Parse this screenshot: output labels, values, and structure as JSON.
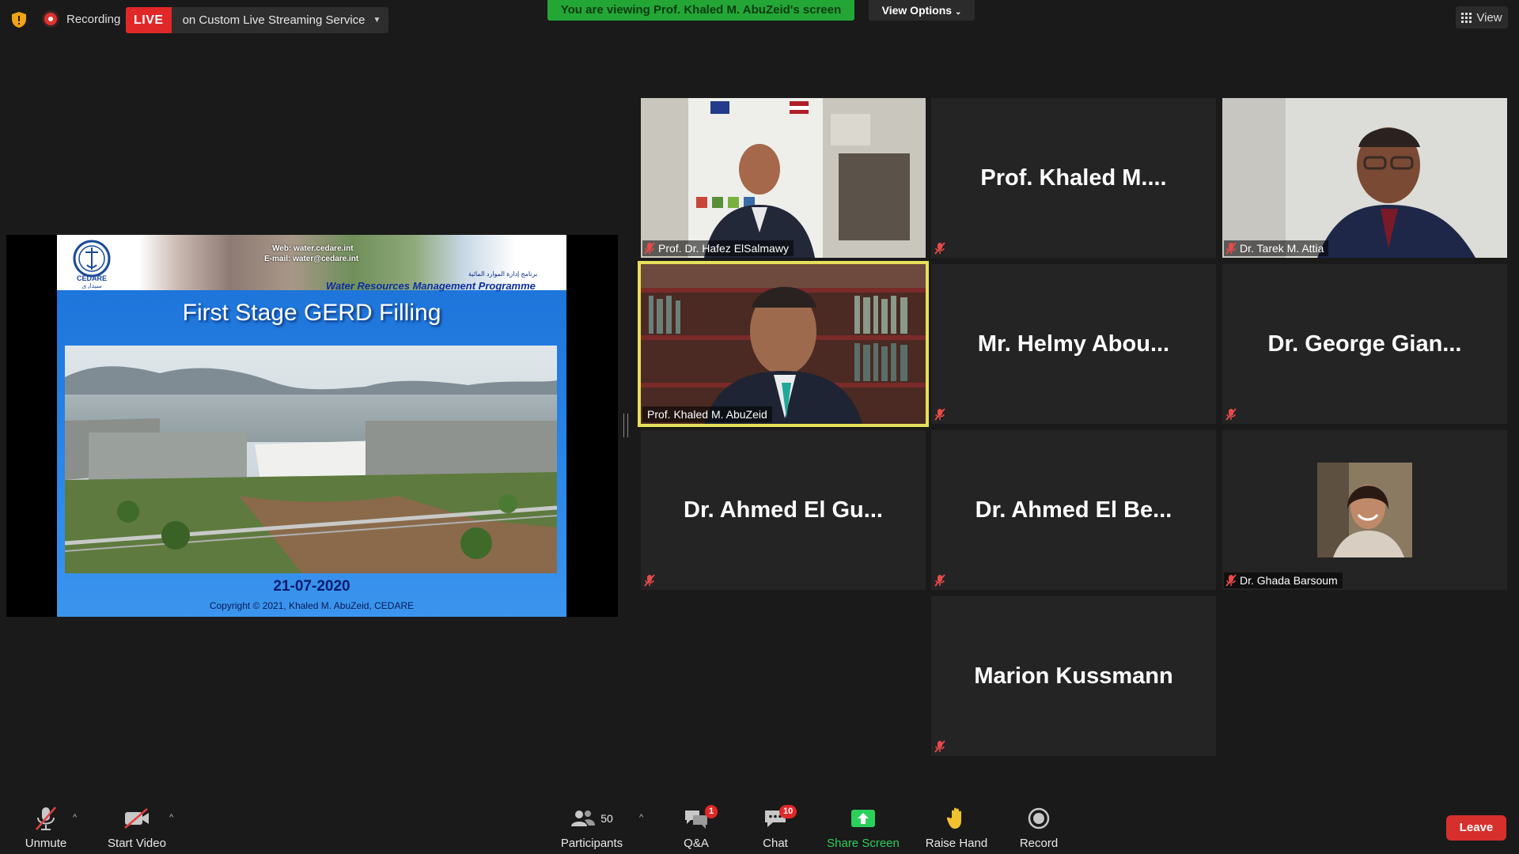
{
  "top_bar": {
    "recording_label": "Recording",
    "live_badge": "LIVE",
    "live_service": "on Custom Live Streaming Service",
    "viewing_banner": "You are viewing Prof. Khaled M. AbuZeid's screen",
    "view_options": "View Options",
    "view_label": "View"
  },
  "shared_slide": {
    "web": "Web: water.cedare.int",
    "email": "E-mail: water@cedare.int",
    "logo_text": "CEDARE",
    "arabic_program": "برنامج إدارة الموارد المائية",
    "program": "Water Resources Management Programme",
    "title": "First Stage GERD Filling",
    "date": "21-07-2020",
    "copyright": "Copyright © 2021, Khaled M. AbuZeid, CEDARE"
  },
  "participants": [
    {
      "name": "Prof. Dr. Hafez ElSalmawy",
      "display": "",
      "video": true,
      "muted": true
    },
    {
      "name": "",
      "display": "Prof. Khaled M....",
      "video": false,
      "muted": true
    },
    {
      "name": "Dr. Tarek M. Attia",
      "display": "",
      "video": true,
      "muted": true
    },
    {
      "name": "Prof. Khaled M. AbuZeid",
      "display": "",
      "video": true,
      "muted": false,
      "active": true
    },
    {
      "name": "",
      "display": "Mr. Helmy Abou...",
      "video": false,
      "muted": true
    },
    {
      "name": "",
      "display": "Dr. George Gian...",
      "video": false,
      "muted": true
    },
    {
      "name": "",
      "display": "Dr. Ahmed El Gu...",
      "video": false,
      "muted": true
    },
    {
      "name": "",
      "display": "Dr. Ahmed El Be...",
      "video": false,
      "muted": true
    },
    {
      "name": "Dr. Ghada Barsoum",
      "display": "",
      "video": true,
      "muted": true
    },
    {
      "name": "",
      "display": "Marion Kussmann",
      "video": false,
      "muted": true
    }
  ],
  "toolbar": {
    "unmute": "Unmute",
    "start_video": "Start Video",
    "participants_label": "Participants",
    "participants_count": "50",
    "qa_label": "Q&A",
    "qa_badge": "1",
    "chat_label": "Chat",
    "chat_badge": "10",
    "share_label": "Share Screen",
    "raise_hand": "Raise Hand",
    "record": "Record",
    "leave": "Leave"
  },
  "colors": {
    "live_red": "#e02828",
    "banner_green": "#23a636",
    "share_green": "#2bd05a",
    "active_speaker": "#e6e05a",
    "leave_red": "#d7302c"
  }
}
